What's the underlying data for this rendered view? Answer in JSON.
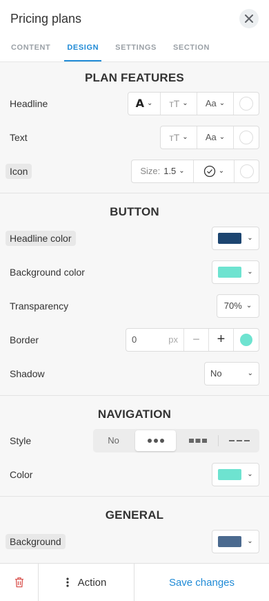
{
  "header": {
    "title": "Pricing plans",
    "tabs": [
      {
        "label": "CONTENT"
      },
      {
        "label": "DESIGN"
      },
      {
        "label": "SETTINGS"
      },
      {
        "label": "SECTION"
      }
    ]
  },
  "plan_features": {
    "title": "PLAN FEATURES",
    "headline_label": "Headline",
    "text_label": "Text",
    "icon_label": "Icon",
    "font_weight_glyph": "A",
    "text_size_glyph": "ᴛT",
    "font_family_glyph": "Aa",
    "icon_size_label": "Size:",
    "icon_size_value": "1.5"
  },
  "button": {
    "title": "BUTTON",
    "headline_color_label": "Headline color",
    "headline_color": "#1c4570",
    "background_color_label": "Background color",
    "background_color": "#6ee3d0",
    "transparency_label": "Transparency",
    "transparency_value": "70%",
    "border_label": "Border",
    "border_value": "0",
    "border_unit": "px",
    "border_minus": "−",
    "border_plus": "+",
    "border_color": "#6ee3d0",
    "shadow_label": "Shadow",
    "shadow_value": "No"
  },
  "navigation": {
    "title": "NAVIGATION",
    "style_label": "Style",
    "style_options": [
      "No",
      "dots",
      "squares",
      "dashes"
    ],
    "style_no_label": "No",
    "color_label": "Color",
    "color": "#6ee3d0"
  },
  "general": {
    "title": "GENERAL",
    "background_label": "Background",
    "background_color": "#4b6a8f"
  },
  "footer": {
    "action_label": "Action",
    "save_label": "Save changes"
  },
  "colors": {
    "accent": "#1f8ad6",
    "danger": "#d9534f"
  }
}
